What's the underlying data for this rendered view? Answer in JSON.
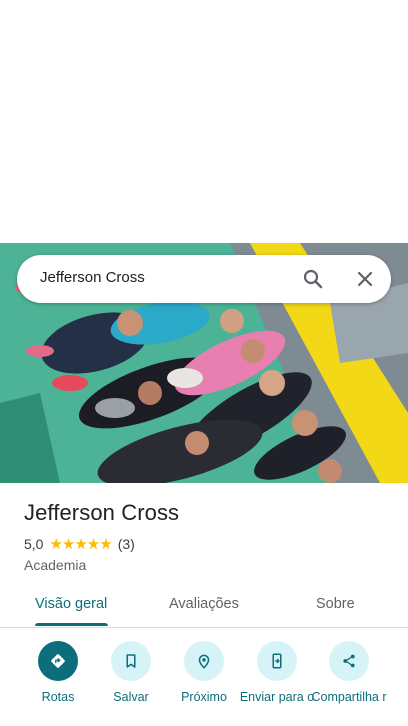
{
  "search": {
    "query": "Jefferson Cross"
  },
  "place": {
    "title": "Jefferson Cross",
    "rating": "5,0",
    "stars": "★★★★★",
    "review_count": "(3)",
    "category": "Academia"
  },
  "tabs": [
    {
      "label": "Visão geral",
      "active": true
    },
    {
      "label": "Avaliações",
      "active": false
    },
    {
      "label": "Sobre",
      "active": false
    }
  ],
  "actions": [
    {
      "label": "Rotas",
      "icon": "directions-icon"
    },
    {
      "label": "Salvar",
      "icon": "bookmark-icon"
    },
    {
      "label": "Próximo",
      "icon": "nearby-icon"
    },
    {
      "label": "Enviar para o",
      "icon": "send-to-phone-icon"
    },
    {
      "label": "Compartilha r",
      "icon": "share-icon"
    }
  ],
  "colors": {
    "accent": "#0b6e7a",
    "accent_light": "#d6f4f8",
    "star": "#fbbc04"
  }
}
